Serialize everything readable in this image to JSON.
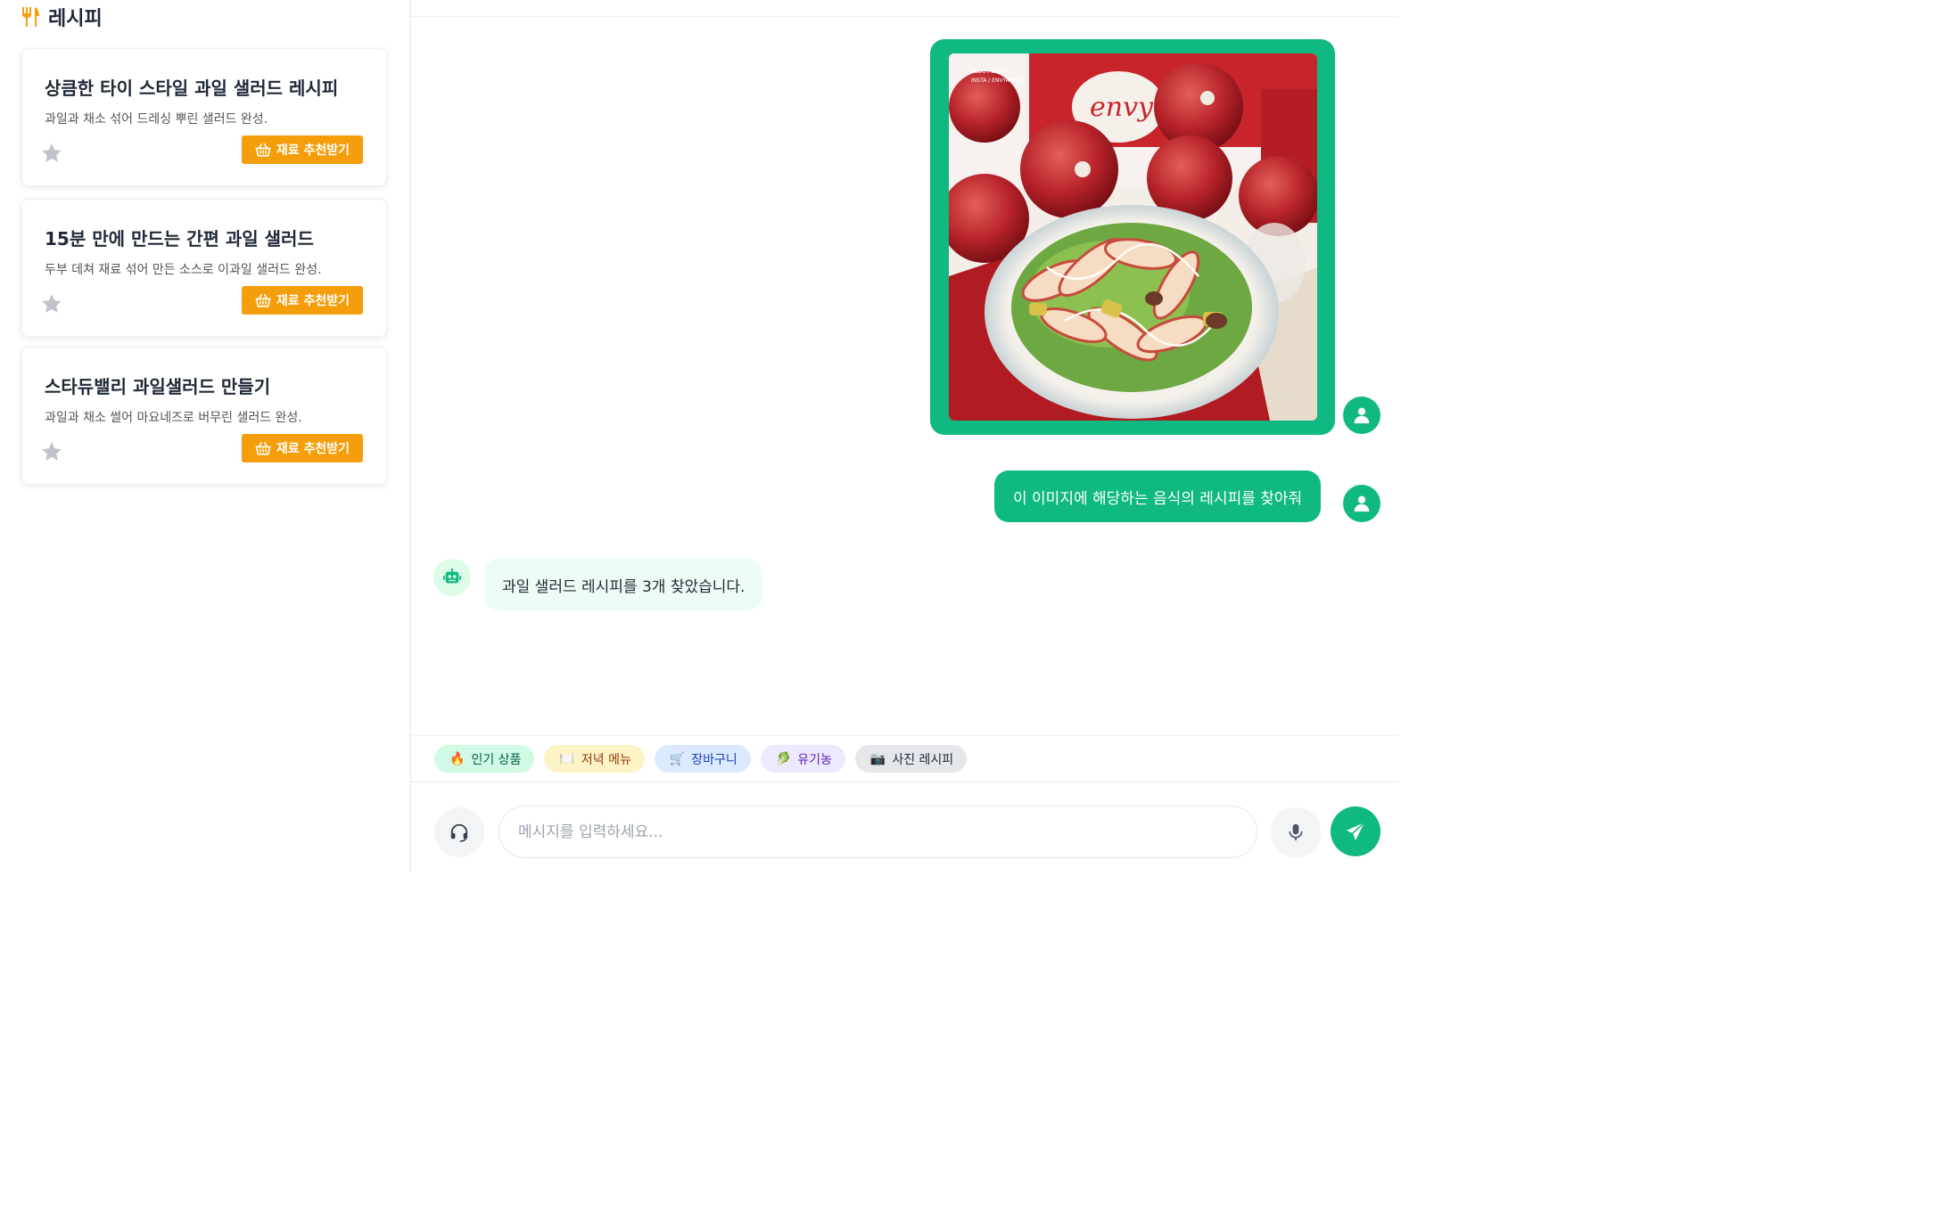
{
  "sidebar": {
    "title": "레시피",
    "recipes": [
      {
        "title": "상큼한 타이 스타일 과일 샐러드 레시피",
        "description": "과일과 채소 섞어 드레싱 뿌린 샐러드 완성.",
        "button_label": "재료 추천받기"
      },
      {
        "title": "15분 만에 만드는 간편 과일 샐러드",
        "description": "두부 데쳐 재료 섞어 만든 소스로 이과일 샐러드 완성.",
        "button_label": "재료 추천받기"
      },
      {
        "title": "스타듀밸리 과일샐러드 만들기",
        "description": "과일과 채소 썰어 마요네즈로 버무린 샐러드 완성.",
        "button_label": "재료 추천받기"
      }
    ]
  },
  "chat": {
    "user_image_alt_text": {
      "line1": "BLOG / ENVY",
      "line2": "INSTA / ENVYAPPLE",
      "brand": "envy"
    },
    "user_message": "이 이미지에 해당하는 음식의 레시피를 찾아줘",
    "bot_message": "과일 샐러드 레시피를 3개 찾았습니다."
  },
  "quick_chips": [
    {
      "label": "인기 상품",
      "icon": "fire-icon",
      "emoji": "🔥"
    },
    {
      "label": "저녁 메뉴",
      "icon": "plate-icon",
      "emoji": "🍽️"
    },
    {
      "label": "장바구니",
      "icon": "cart-icon",
      "emoji": "🛒"
    },
    {
      "label": "유기농",
      "icon": "leaf-icon",
      "emoji": "🥬"
    },
    {
      "label": "사진 레시피",
      "icon": "camera-icon",
      "emoji": "📷"
    }
  ],
  "composer": {
    "placeholder": "메시지를 입력하세요..."
  },
  "colors": {
    "accent": "#10b981",
    "button": "#f59e0b",
    "logo": "#f59e0b"
  }
}
